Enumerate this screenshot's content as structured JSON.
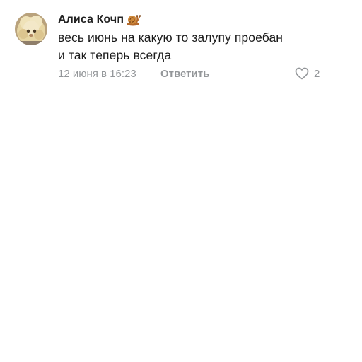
{
  "comment": {
    "author": "Алиса Кочп",
    "author_badge_icon": "snail-icon",
    "text_lines": [
      "весь июнь на какую то залупу проебан",
      "и так теперь всегда"
    ],
    "timestamp": "12 июня в 16:23",
    "reply_label": "Ответить",
    "like_icon": "heart-outline-icon",
    "like_count": "2"
  },
  "colors": {
    "background": "#ffffff",
    "text": "#1b1b1b",
    "meta": "#939699"
  }
}
